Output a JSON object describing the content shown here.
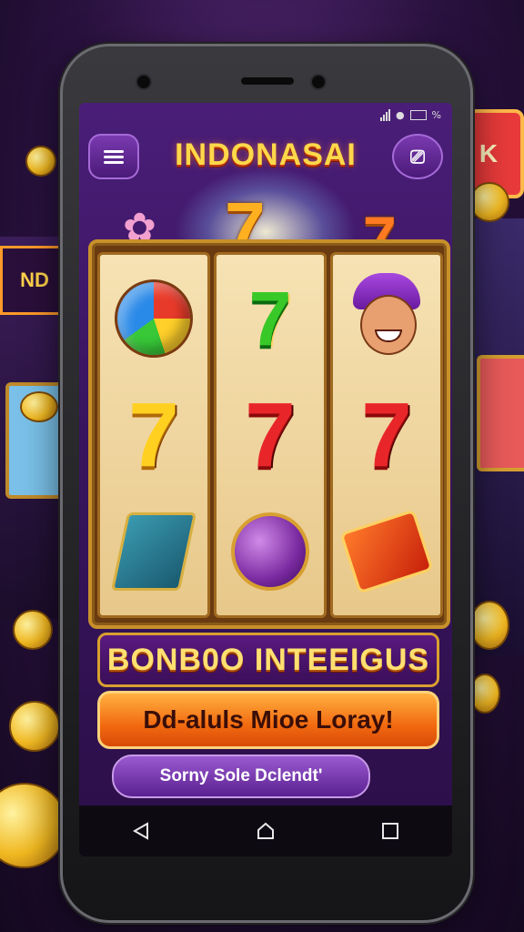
{
  "status": {
    "icons": [
      "signal-icon",
      "notification-icon",
      "battery-icon"
    ],
    "text": "% "
  },
  "header": {
    "title": "INDONASAI",
    "menu_icon": "hamburger-menu-icon",
    "action_icon": "door-exit-icon",
    "action_glyph": "⎚"
  },
  "decor": {
    "top_seven_center": "7",
    "top_seven_right": "7"
  },
  "reels": [
    [
      "ball",
      "7",
      "card"
    ],
    [
      "7",
      "7",
      "orb"
    ],
    [
      "genie",
      "7",
      "ticket"
    ]
  ],
  "seven_glyph": "7",
  "bonus_banner": "BONB0O INTEEIGUS",
  "cta_button": "Dd-aluls Mioe Loray!",
  "secondary_button": "Sorny Sole Dclendt'",
  "nav": {
    "back": "back-icon",
    "home": "home-icon",
    "recents": "recents-icon"
  },
  "colors": {
    "accent": "#ffd84a",
    "cta": "#f26a10",
    "purple": "#4a1e78"
  }
}
